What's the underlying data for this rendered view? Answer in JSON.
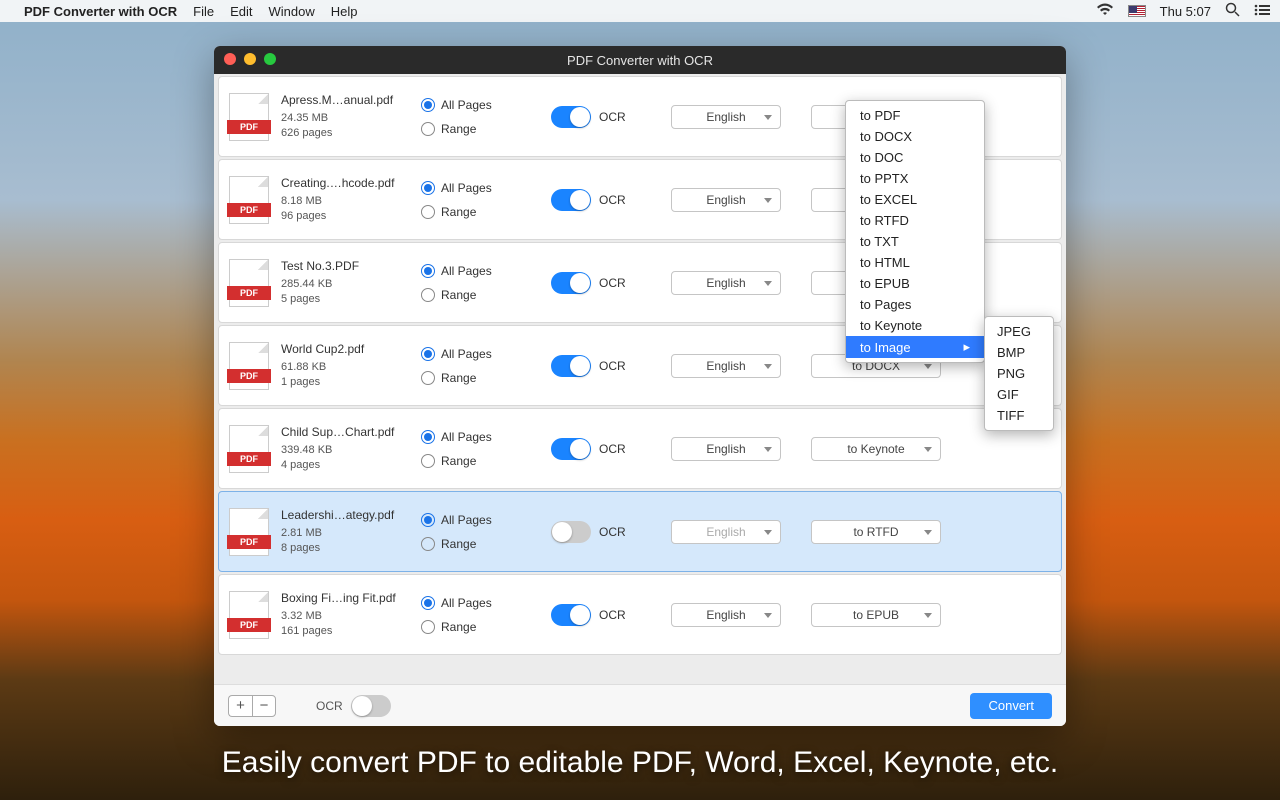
{
  "menubar": {
    "app": "PDF Converter with OCR",
    "items": [
      "File",
      "Edit",
      "Window",
      "Help"
    ],
    "clock": "Thu 5:07"
  },
  "window": {
    "title": "PDF Converter with OCR"
  },
  "radiolabels": {
    "all": "All Pages",
    "range": "Range"
  },
  "ocr_label": "OCR",
  "files": [
    {
      "name": "Apress.M…anual.pdf",
      "size": "24.35 MB",
      "pages": "626 pages",
      "ocr": true,
      "lang": "English",
      "fmt": ""
    },
    {
      "name": "Creating.…hcode.pdf",
      "size": "8.18 MB",
      "pages": "96 pages",
      "ocr": true,
      "lang": "English",
      "fmt": ""
    },
    {
      "name": "Test No.3.PDF",
      "size": "285.44 KB",
      "pages": "5 pages",
      "ocr": true,
      "lang": "English",
      "fmt": ""
    },
    {
      "name": "World Cup2.pdf",
      "size": "61.88 KB",
      "pages": "1 pages",
      "ocr": true,
      "lang": "English",
      "fmt": "to DOCX"
    },
    {
      "name": "Child Sup…Chart.pdf",
      "size": "339.48 KB",
      "pages": "4 pages",
      "ocr": true,
      "lang": "English",
      "fmt": "to Keynote"
    },
    {
      "name": "Leadershi…ategy.pdf",
      "size": "2.81 MB",
      "pages": "8 pages",
      "ocr": false,
      "lang": "English",
      "fmt": "to RTFD",
      "selected": true
    },
    {
      "name": "Boxing Fi…ing Fit.pdf",
      "size": "3.32 MB",
      "pages": "161 pages",
      "ocr": true,
      "lang": "English",
      "fmt": "to EPUB"
    }
  ],
  "format_menu": {
    "options": [
      "to PDF",
      "to DOCX",
      "to DOC",
      "to PPTX",
      "to EXCEL",
      "to RTFD",
      "to TXT",
      "to HTML",
      "to EPUB",
      "to Pages",
      "to Keynote",
      "to Image"
    ],
    "highlighted": "to Image",
    "submenu": [
      "JPEG",
      "BMP",
      "PNG",
      "GIF",
      "TIFF"
    ]
  },
  "footer": {
    "ocr_label": "OCR",
    "convert": "Convert"
  },
  "caption": "Easily convert PDF to editable PDF, Word, Excel, Keynote, etc."
}
